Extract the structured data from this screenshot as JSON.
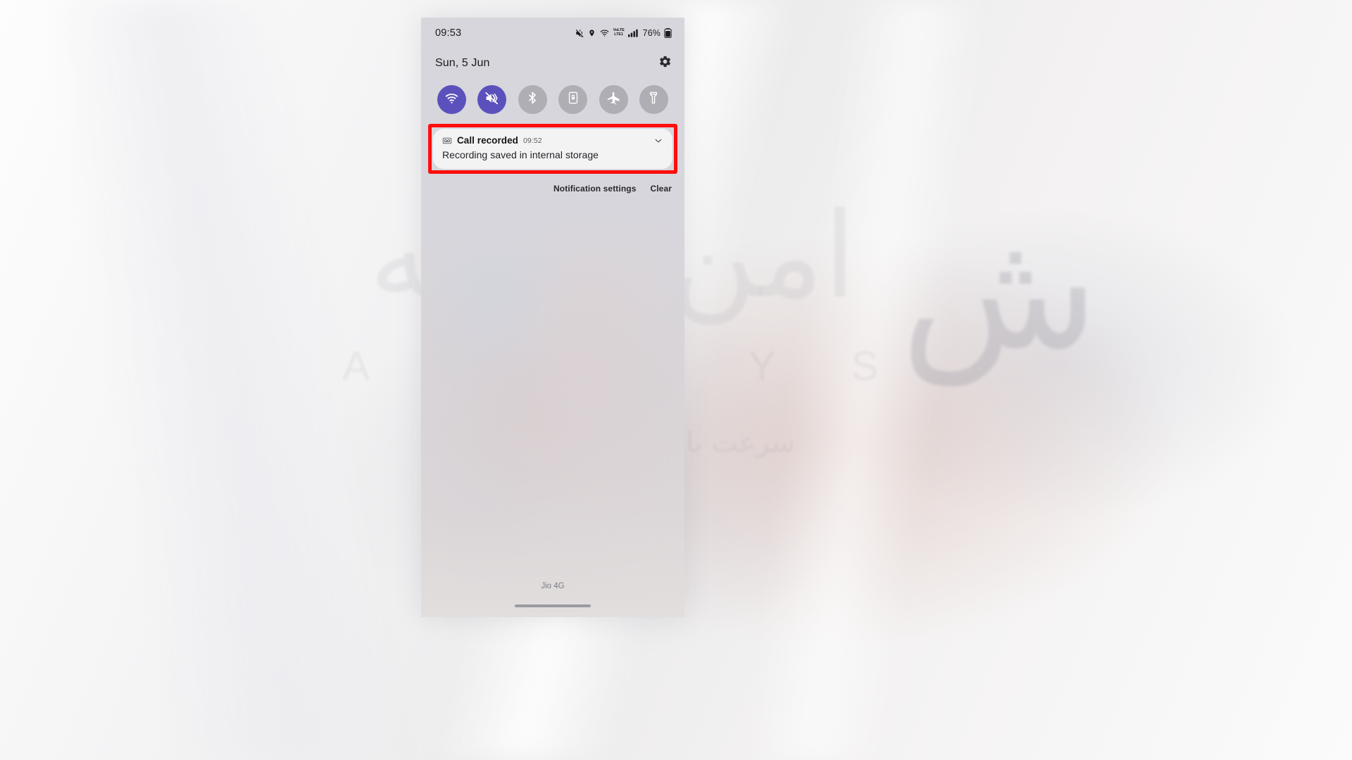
{
  "watermark": {
    "arabic": "امن شبکه",
    "latin": "A Z A R Y S",
    "persian": "سرعت بالاترین میزبانی وب",
    "mark": "ش"
  },
  "phone": {
    "status_bar": {
      "time": "09:53",
      "battery_percent": "76%",
      "icons": [
        "mute-icon",
        "location-icon",
        "wifi-icon",
        "volte-icon",
        "signal-bars-icon",
        "battery-icon"
      ],
      "volte_label_top": "VoLTE",
      "volte_label_bottom": "LTE1"
    },
    "panel_header": {
      "date": "Sun, 5 Jun",
      "settings_icon": "gear-icon"
    },
    "quick_toggles": [
      {
        "name": "wifi",
        "label": "Wi-Fi",
        "icon": "wifi-icon",
        "state": "on"
      },
      {
        "name": "sound-mode",
        "label": "Mute",
        "icon": "mute-vibrate-icon",
        "state": "on"
      },
      {
        "name": "bluetooth",
        "label": "Bluetooth",
        "icon": "bluetooth-icon",
        "state": "off"
      },
      {
        "name": "screen-lock",
        "label": "Auto rotate",
        "icon": "screen-lock-icon",
        "state": "off"
      },
      {
        "name": "airplane",
        "label": "Flight mode",
        "icon": "airplane-icon",
        "state": "off"
      },
      {
        "name": "flashlight",
        "label": "Flashlight",
        "icon": "flashlight-icon",
        "state": "off"
      }
    ],
    "notification": {
      "app_icon": "voice-recorder-icon",
      "title": "Call recorded",
      "time": "09:52",
      "body": "Recording saved in internal storage",
      "expand_icon": "chevron-down-icon",
      "highlight_color": "#fd0d0d"
    },
    "notification_actions": {
      "settings_label": "Notification settings",
      "clear_label": "Clear"
    },
    "footer": {
      "carrier": "Jio 4G",
      "home_indicator": "home-indicator"
    }
  },
  "theme": {
    "toggle_on_color": "#5b51bd",
    "toggle_off_color": "#aeaeb4",
    "highlight_color": "#fd0d0d"
  }
}
